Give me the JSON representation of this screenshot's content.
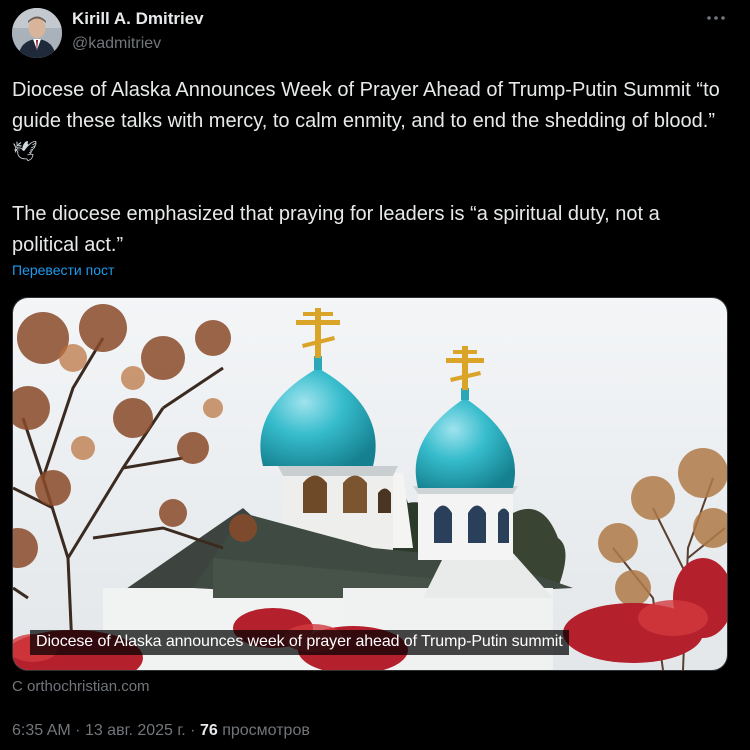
{
  "author": {
    "name": "Kirill A. Dmitriev",
    "handle": "@kadmitriev"
  },
  "post": {
    "paragraph_1": "Diocese of Alaska Announces Week of Prayer Ahead of Trump-Putin Summit “to guide these talks with mercy, to calm enmity, and to end the shedding of blood.”",
    "paragraph_1_emoji": "🕊",
    "paragraph_2": "The diocese emphasized that praying for leaders is “a spiritual duty, not a political act.”",
    "translate_label": "Перевести пост"
  },
  "card": {
    "caption": "Diocese of Alaska announces week of prayer ahead of Trump-Putin summit",
    "source": "С orthochristian.com"
  },
  "meta": {
    "time": "6:35 AM",
    "separator": "·",
    "date": "13 авг. 2025 г.",
    "views_count": "76",
    "views_label": "просмотров"
  },
  "icons": {
    "more": "more-horizontal-icon",
    "dove": "dove-emoji"
  },
  "colors": {
    "background": "#000000",
    "text_primary": "#e7e9ea",
    "text_secondary": "#71767b",
    "link": "#1d9bf0",
    "dome": "#2fb8c9"
  }
}
